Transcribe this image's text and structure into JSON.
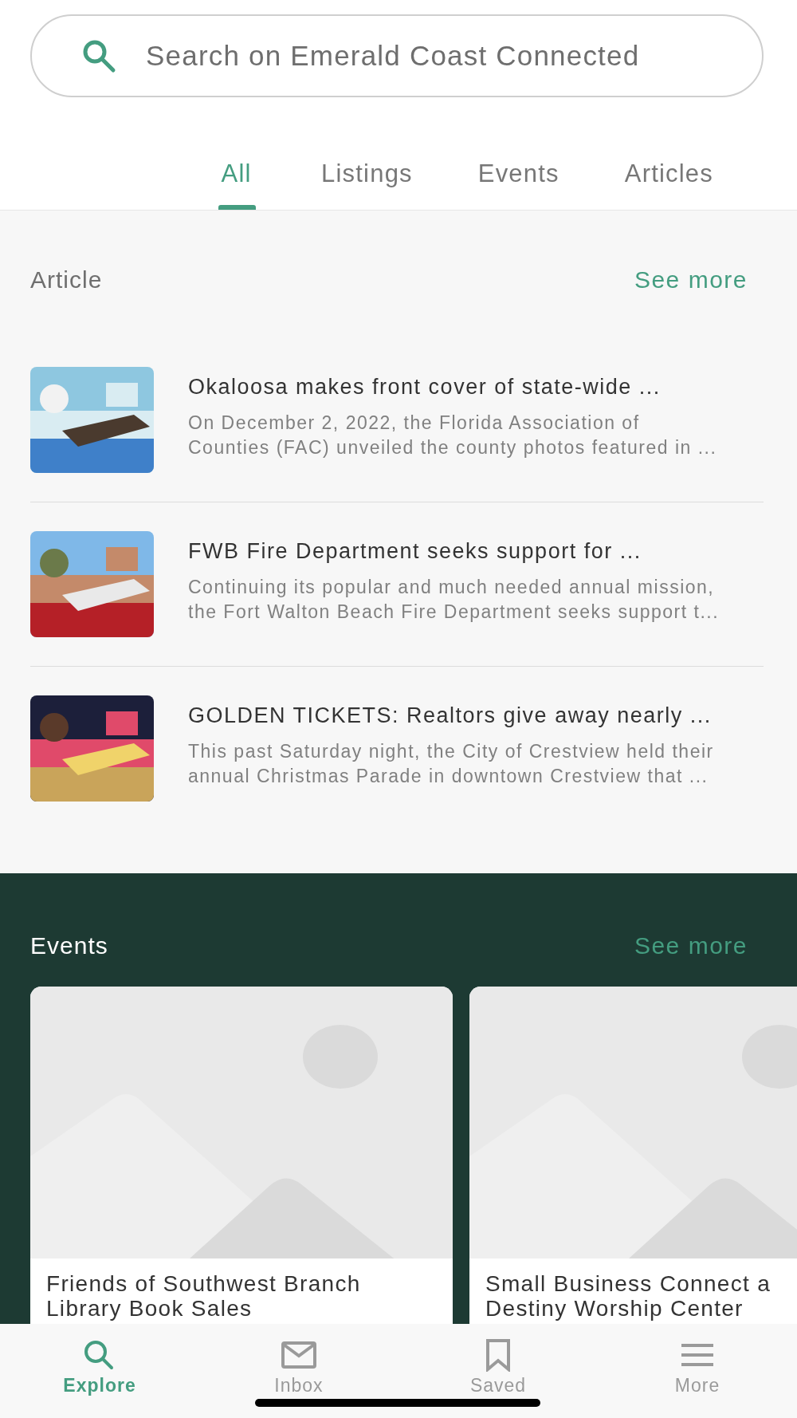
{
  "search": {
    "placeholder": "Search on Emerald Coast Connected"
  },
  "tabs": [
    {
      "label": "All",
      "selected": true
    },
    {
      "label": "Listings",
      "selected": false
    },
    {
      "label": "Events",
      "selected": false
    },
    {
      "label": "Articles",
      "selected": false
    }
  ],
  "articles_section": {
    "title": "Article",
    "see_more": "See more",
    "items": [
      {
        "title": "Okaloosa makes front cover of state-wide ...",
        "lines": [
          "On December 2, 2022, the Florida Association of",
          "Counties (FAC) unveiled the county photos featured in ..."
        ],
        "thumbnail": {
          "kind": "picture"
        }
      },
      {
        "title": "FWB Fire Department seeks support for ...",
        "lines": [
          "Continuing its popular and much needed annual mission,",
          "the Fort Walton Beach Fire Department seeks support t..."
        ],
        "thumbnail": {
          "kind": "picture"
        }
      },
      {
        "title": "GOLDEN TICKETS: Realtors give away nearly ...",
        "lines": [
          "This past Saturday night, the City of Crestview held their",
          "annual Christmas Parade in downtown Crestview that ..."
        ],
        "thumbnail": {
          "kind": "picture"
        }
      }
    ]
  },
  "events_section": {
    "title": "Events",
    "see_more": "See more",
    "cards": [
      {
        "lines": [
          "Friends of Southwest Branch",
          "Library Book Sales"
        ]
      },
      {
        "lines": [
          "Small Business Connect a",
          "Destiny Worship Center"
        ]
      }
    ]
  },
  "bottom_nav": [
    {
      "label": "Explore",
      "selected": true
    },
    {
      "label": "Inbox",
      "selected": false
    },
    {
      "label": "Saved",
      "selected": false
    },
    {
      "label": "More",
      "selected": false
    }
  ]
}
